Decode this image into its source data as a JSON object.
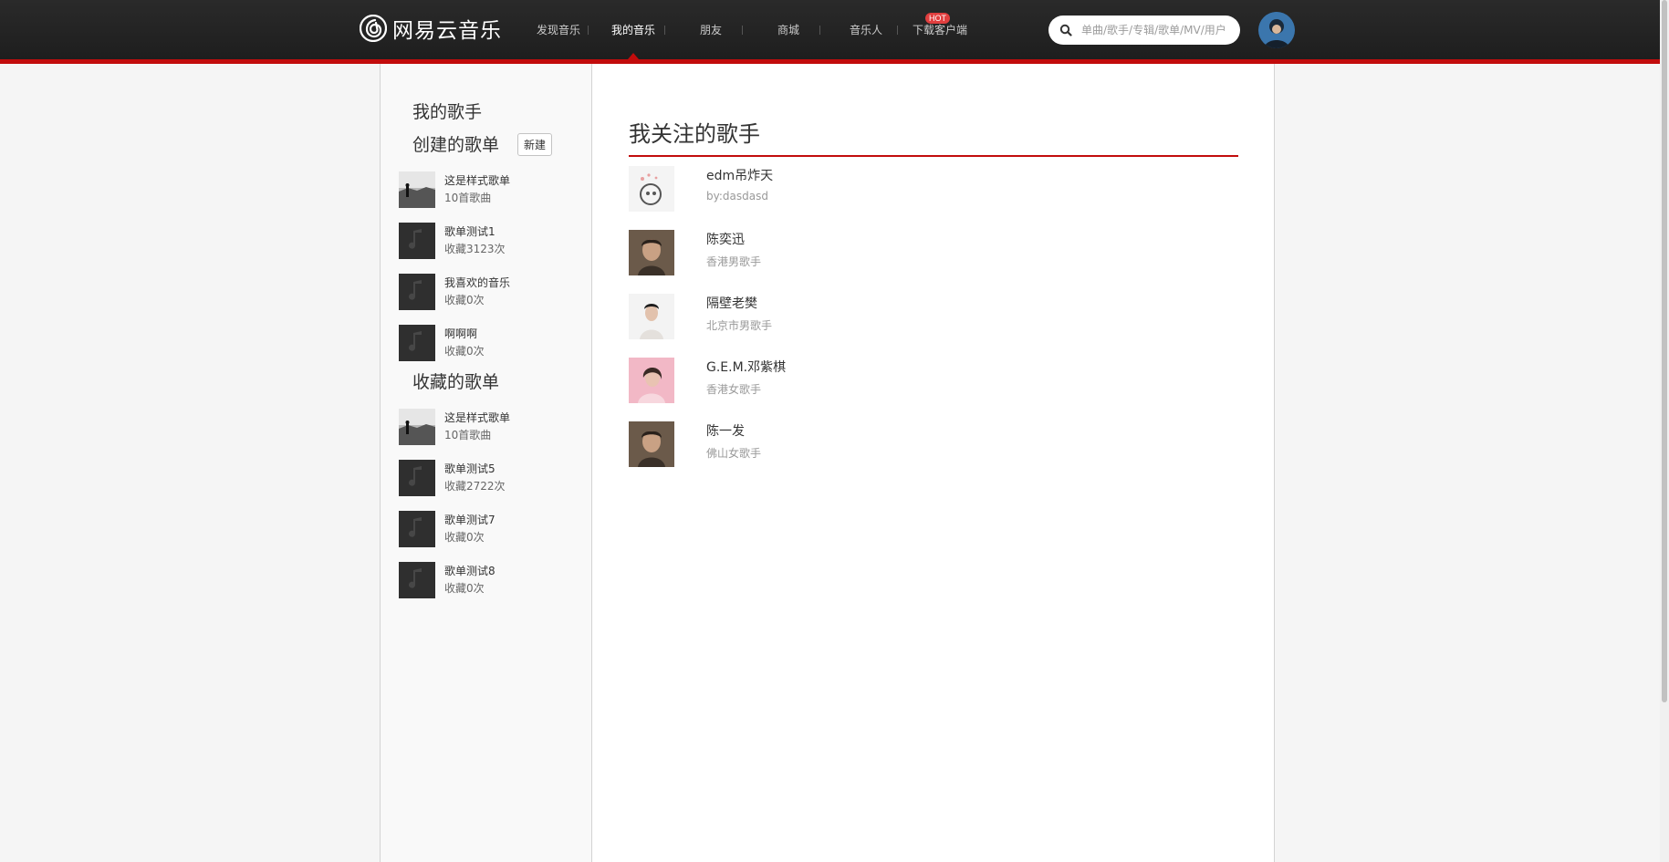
{
  "app": {
    "logo_text": "网易云音乐"
  },
  "nav": {
    "items": [
      {
        "label": "发现音乐"
      },
      {
        "label": "我的音乐"
      },
      {
        "label": "朋友"
      },
      {
        "label": "商城"
      },
      {
        "label": "音乐人"
      },
      {
        "label": "下载客户端"
      }
    ],
    "active_index": 1,
    "hot_badge": "HOT"
  },
  "search": {
    "placeholder": "单曲/歌手/专辑/歌单/MV/用户"
  },
  "sidebar": {
    "my_artists_heading": "我的歌手",
    "created_heading": "创建的歌单",
    "new_button_label": "新建",
    "created_playlists": [
      {
        "name": "这是样式歌单",
        "sub": "10首歌曲",
        "thumb": "photo-icon"
      },
      {
        "name": "歌单测试1",
        "sub": "收藏3123次",
        "thumb": "music-note-icon"
      },
      {
        "name": "我喜欢的音乐",
        "sub": "收藏0次",
        "thumb": "music-note-icon"
      },
      {
        "name": "啊啊啊",
        "sub": "收藏0次",
        "thumb": "music-note-icon"
      }
    ],
    "collected_heading": "收藏的歌单",
    "collected_playlists": [
      {
        "name": "这是样式歌单",
        "sub": "10首歌曲",
        "thumb": "photo-icon"
      },
      {
        "name": "歌单测试5",
        "sub": "收藏2722次",
        "thumb": "music-note-icon"
      },
      {
        "name": "歌单测试7",
        "sub": "收藏0次",
        "thumb": "music-note-icon"
      },
      {
        "name": "歌单测试8",
        "sub": "收藏0次",
        "thumb": "music-note-icon"
      }
    ]
  },
  "main": {
    "title": "我关注的歌手",
    "artists": [
      {
        "name": "edm吊炸天",
        "desc": "by:dasdasd"
      },
      {
        "name": "陈奕迅",
        "desc": "香港男歌手"
      },
      {
        "name": "隔壁老樊",
        "desc": "北京市男歌手"
      },
      {
        "name": "G.E.M.邓紫棋",
        "desc": "香港女歌手"
      },
      {
        "name": "陈一发",
        "desc": "佛山女歌手"
      }
    ]
  },
  "colors": {
    "accent": "#c20c0c",
    "topbar": "#242424",
    "sidebar_bg": "#f9f9f9"
  }
}
